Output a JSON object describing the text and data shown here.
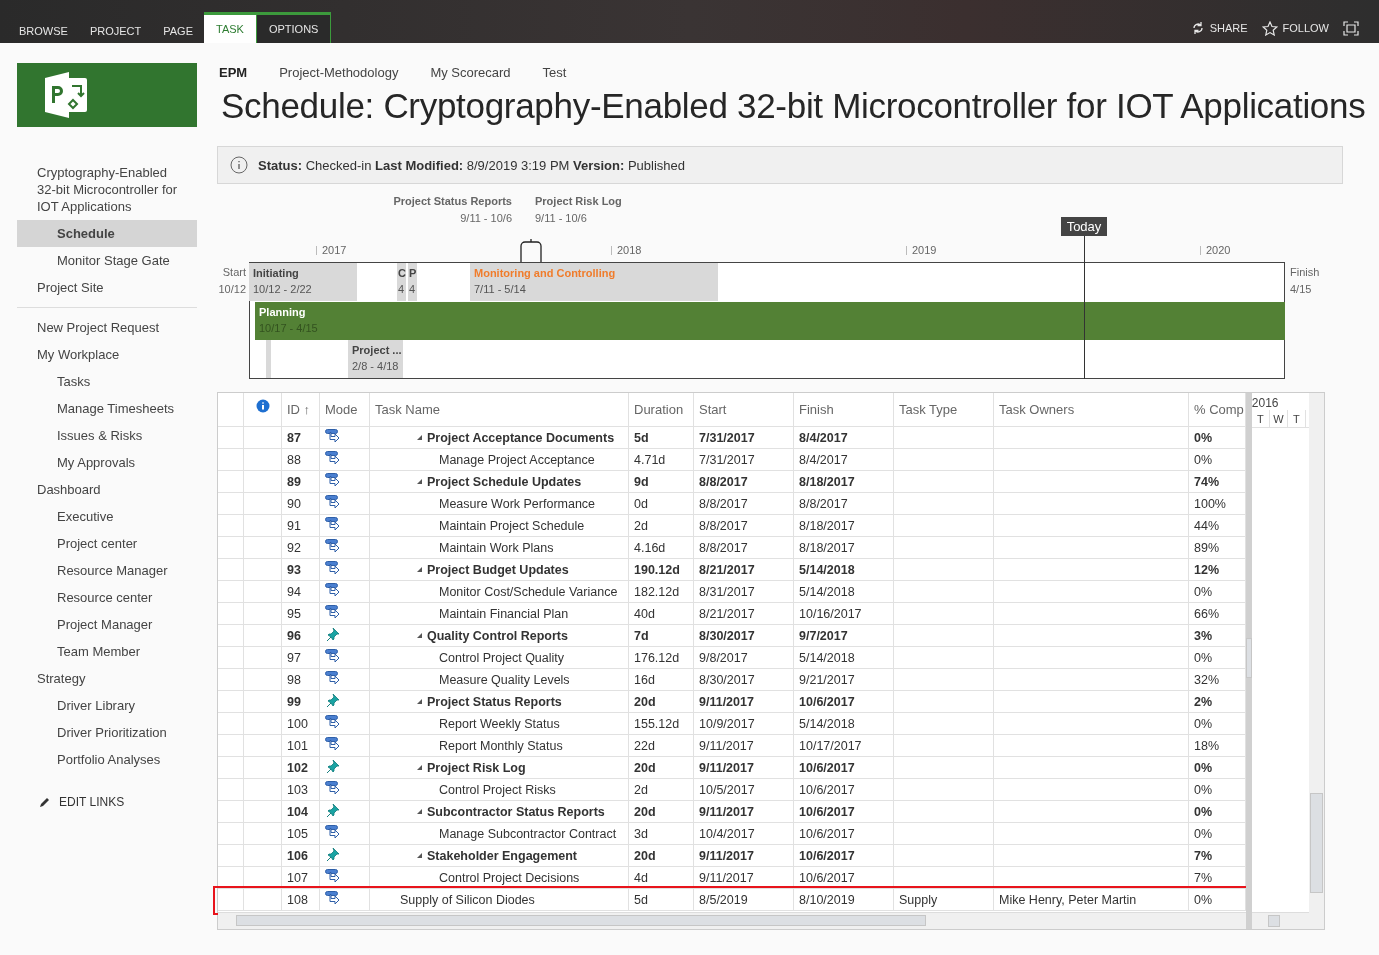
{
  "ribbon": {
    "tabs": [
      {
        "label": "BROWSE",
        "selected": false,
        "contextual": false
      },
      {
        "label": "PROJECT",
        "selected": false,
        "contextual": false
      },
      {
        "label": "PAGE",
        "selected": false,
        "contextual": false
      },
      {
        "label": "TASK",
        "selected": true,
        "contextual": true
      },
      {
        "label": "OPTIONS",
        "selected": false,
        "contextual": true
      }
    ],
    "actions": [
      {
        "label": "SHARE",
        "kind": "share"
      },
      {
        "label": "FOLLOW",
        "kind": "follow"
      }
    ]
  },
  "top_nav": [
    {
      "label": "EPM",
      "selected": true
    },
    {
      "label": "Project-Methodology",
      "selected": false
    },
    {
      "label": "My Scorecard",
      "selected": false
    },
    {
      "label": "Test",
      "selected": false
    }
  ],
  "page_title": "Schedule: Cryptography-Enabled 32-bit Microcontroller for IOT Applications",
  "sidebar": {
    "items": [
      {
        "label": "Cryptography-Enabled 32-bit Microcontroller for IOT Applications",
        "selected": false,
        "children": [
          {
            "label": "Schedule",
            "selected": true
          },
          {
            "label": "Monitor Stage Gate",
            "selected": false
          }
        ]
      },
      {
        "label": "Project Site",
        "selected": false
      },
      {
        "kind": "divider"
      },
      {
        "label": "New Project Request",
        "selected": false
      },
      {
        "label": "My Workplace",
        "selected": false,
        "children": [
          {
            "label": "Tasks",
            "selected": false
          },
          {
            "label": "Manage Timesheets",
            "selected": false
          },
          {
            "label": "Issues & Risks",
            "selected": false
          },
          {
            "label": "My Approvals",
            "selected": false
          }
        ]
      },
      {
        "label": "Dashboard",
        "selected": false,
        "children": [
          {
            "label": "Executive",
            "selected": false
          },
          {
            "label": "Project center",
            "selected": false
          },
          {
            "label": "Resource Manager",
            "selected": false
          },
          {
            "label": "Resource center",
            "selected": false
          },
          {
            "label": "Project Manager",
            "selected": false
          },
          {
            "label": "Team Member",
            "selected": false
          }
        ]
      },
      {
        "label": "Strategy",
        "selected": false,
        "children": [
          {
            "label": "Driver Library",
            "selected": false
          },
          {
            "label": "Driver Prioritization",
            "selected": false
          },
          {
            "label": "Portfolio Analyses",
            "selected": false
          }
        ]
      }
    ],
    "edit_links": "EDIT LINKS"
  },
  "status_bar": "**Status:** Checked-in **Last Modified:** 8/9/2019 3:19 PM **Version:** Published",
  "timeline": {
    "start_label": "Start",
    "start_date": "10/12",
    "finish_label": "Finish",
    "finish_date": "4/15",
    "years": [
      "2017",
      "2018",
      "2019",
      "2020"
    ],
    "today": "Today",
    "milestones": [
      {
        "name": "Project Status Reports",
        "dates": "9/11 - 10/6"
      },
      {
        "name": "Project Risk Log",
        "dates": "9/11 - 10/6"
      }
    ],
    "bars": [
      {
        "kind": "phase",
        "name": "Initiating",
        "dates": "10/12 - 2/22"
      },
      {
        "kind": "phase",
        "name": "C",
        "dates": "4"
      },
      {
        "kind": "phase",
        "name": "P",
        "dates": "4"
      },
      {
        "kind": "current",
        "name": "Monitoring and Controlling",
        "dates": "7/11 - 5/14"
      },
      {
        "kind": "overall",
        "name": "Planning",
        "dates": "10/17 - 4/15"
      },
      {
        "kind": "phase"
      },
      {
        "kind": "phase",
        "name": "Project ...",
        "dates": "2/8 - 4/18"
      }
    ]
  },
  "grid": {
    "columns": [
      "ID ↑",
      "Mode",
      "Task Name",
      "Duration",
      "Start",
      "Finish",
      "Task Type",
      "Task Owners",
      "% Comp"
    ],
    "rows": [
      {
        "id": "87",
        "manually_scheduled": false,
        "name": "Project Acceptance Documents",
        "duration": "5d",
        "start": "7/31/2017",
        "finish": "8/4/2017",
        "complete": "0%",
        "highlighted": false,
        "children": [
          {
            "id": "88",
            "manually_scheduled": false,
            "name": "Manage Project Acceptance",
            "duration": "4.71d",
            "start": "7/31/2017",
            "finish": "8/4/2017",
            "complete": "0%",
            "highlighted": false
          }
        ]
      },
      {
        "id": "89",
        "manually_scheduled": false,
        "name": "Project Schedule Updates",
        "duration": "9d",
        "start": "8/8/2017",
        "finish": "8/18/2017",
        "complete": "74%",
        "highlighted": false,
        "children": [
          {
            "id": "90",
            "manually_scheduled": false,
            "name": "Measure Work Performance",
            "duration": "0d",
            "start": "8/8/2017",
            "finish": "8/8/2017",
            "complete": "100%",
            "highlighted": false
          },
          {
            "id": "91",
            "manually_scheduled": false,
            "name": "Maintain Project Schedule",
            "duration": "2d",
            "start": "8/8/2017",
            "finish": "8/18/2017",
            "complete": "44%",
            "highlighted": false
          },
          {
            "id": "92",
            "manually_scheduled": false,
            "name": "Maintain Work Plans",
            "duration": "4.16d",
            "start": "8/8/2017",
            "finish": "8/18/2017",
            "complete": "89%",
            "highlighted": false
          }
        ]
      },
      {
        "id": "93",
        "manually_scheduled": false,
        "name": "Project Budget Updates",
        "duration": "190.12d",
        "start": "8/21/2017",
        "finish": "5/14/2018",
        "complete": "12%",
        "highlighted": false,
        "children": [
          {
            "id": "94",
            "manually_scheduled": false,
            "name": "Monitor Cost/Schedule Variance",
            "duration": "182.12d",
            "start": "8/31/2017",
            "finish": "5/14/2018",
            "complete": "0%",
            "highlighted": false
          },
          {
            "id": "95",
            "manually_scheduled": false,
            "name": "Maintain Financial Plan",
            "duration": "40d",
            "start": "8/21/2017",
            "finish": "10/16/2017",
            "complete": "66%",
            "highlighted": false
          }
        ]
      },
      {
        "id": "96",
        "manually_scheduled": true,
        "name": "Quality Control Reports",
        "duration": "7d",
        "start": "8/30/2017",
        "finish": "9/7/2017",
        "complete": "3%",
        "highlighted": false,
        "children": [
          {
            "id": "97",
            "manually_scheduled": false,
            "name": "Control Project Quality",
            "duration": "176.12d",
            "start": "9/8/2017",
            "finish": "5/14/2018",
            "complete": "0%",
            "highlighted": false
          },
          {
            "id": "98",
            "manually_scheduled": false,
            "name": "Measure Quality Levels",
            "duration": "16d",
            "start": "8/30/2017",
            "finish": "9/21/2017",
            "complete": "32%",
            "highlighted": false
          }
        ]
      },
      {
        "id": "99",
        "manually_scheduled": true,
        "name": "Project Status Reports",
        "duration": "20d",
        "start": "9/11/2017",
        "finish": "10/6/2017",
        "complete": "2%",
        "highlighted": false,
        "children": [
          {
            "id": "100",
            "manually_scheduled": false,
            "name": "Report Weekly Status",
            "duration": "155.12d",
            "start": "10/9/2017",
            "finish": "5/14/2018",
            "complete": "0%",
            "highlighted": false
          },
          {
            "id": "101",
            "manually_scheduled": false,
            "name": "Report Monthly Status",
            "duration": "22d",
            "start": "9/11/2017",
            "finish": "10/17/2017",
            "complete": "18%",
            "highlighted": false
          }
        ]
      },
      {
        "id": "102",
        "manually_scheduled": true,
        "name": "Project Risk Log",
        "duration": "20d",
        "start": "9/11/2017",
        "finish": "10/6/2017",
        "complete": "0%",
        "highlighted": false,
        "children": [
          {
            "id": "103",
            "manually_scheduled": false,
            "name": "Control Project Risks",
            "duration": "2d",
            "start": "10/5/2017",
            "finish": "10/6/2017",
            "complete": "0%",
            "highlighted": false
          }
        ]
      },
      {
        "id": "104",
        "manually_scheduled": true,
        "name": "Subcontractor Status Reports",
        "duration": "20d",
        "start": "9/11/2017",
        "finish": "10/6/2017",
        "complete": "0%",
        "highlighted": false,
        "children": [
          {
            "id": "105",
            "manually_scheduled": false,
            "name": "Manage Subcontractor Contract",
            "duration": "3d",
            "start": "10/4/2017",
            "finish": "10/6/2017",
            "complete": "0%",
            "highlighted": false
          }
        ]
      },
      {
        "id": "106",
        "manually_scheduled": true,
        "name": "Stakeholder Engagement",
        "duration": "20d",
        "start": "9/11/2017",
        "finish": "10/6/2017",
        "complete": "7%",
        "highlighted": false,
        "children": [
          {
            "id": "107",
            "manually_scheduled": false,
            "name": "Control Project Decisions",
            "duration": "4d",
            "start": "9/11/2017",
            "finish": "10/6/2017",
            "complete": "7%",
            "highlighted": false
          }
        ]
      },
      {
        "id": "108",
        "manually_scheduled": false,
        "name": "Supply of Silicon Diodes",
        "duration": "5d",
        "start": "8/5/2019",
        "finish": "8/10/2019",
        "task_type": "Supply",
        "owners": "Mike Henry, Peter Martin",
        "complete": "0%",
        "highlighted": true
      }
    ]
  },
  "gantt": {
    "year": "2016",
    "days": [
      "T",
      "W",
      "T"
    ]
  }
}
